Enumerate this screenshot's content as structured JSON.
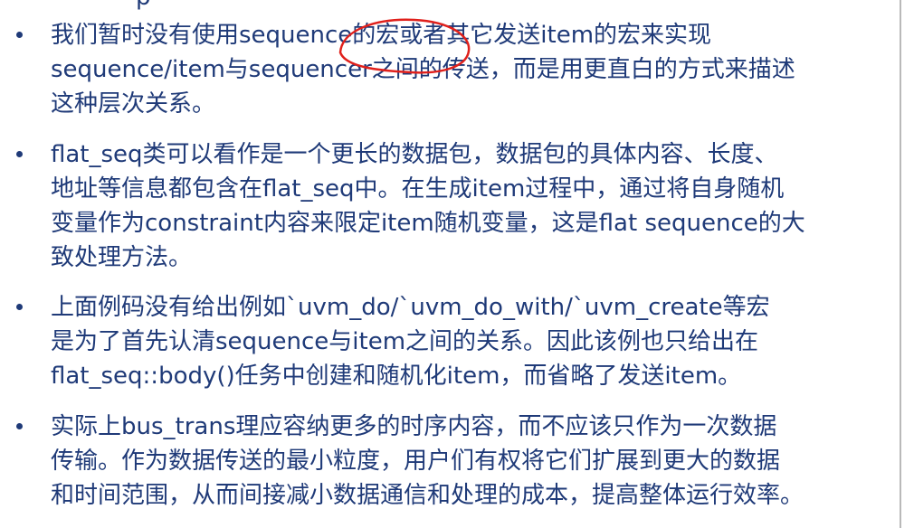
{
  "top_fragment": "p",
  "bullets": [
    {
      "lines": [
        "我们暂时没有使用sequence的宏或者其它发送item的宏来实现",
        "sequence/item与sequencer之间的传送，而是用更直白的方式来描述",
        "这种层次关系。"
      ]
    },
    {
      "lines": [
        "flat_seq类可以看作是一个更长的数据包，数据包的具体内容、长度、",
        "地址等信息都包含在flat_seq中。在生成item过程中，通过将自身随机",
        "变量作为constraint内容来限定item随机变量，这是flat sequence的大",
        "致处理方法。"
      ]
    },
    {
      "lines": [
        "上面例码没有给出例如`uvm_do/`uvm_do_with/`uvm_create等宏",
        "是为了首先认清sequence与item之间的关系。因此该例也只给出在",
        "flat_seq::body()任务中创建和随机化item，而省略了发送item。"
      ]
    },
    {
      "lines": [
        "实际上bus_trans理应容纳更多的时序内容，而不应该只作为一次数据",
        "传输。作为数据传送的最小粒度，用户们有权将它们扩展到更大的数据",
        "和时间范围，从而间接减小数据通信和处理的成本，提高整体运行效率。"
      ]
    }
  ],
  "colors": {
    "text": "#1f3a78",
    "annotation": "#e0201b"
  }
}
